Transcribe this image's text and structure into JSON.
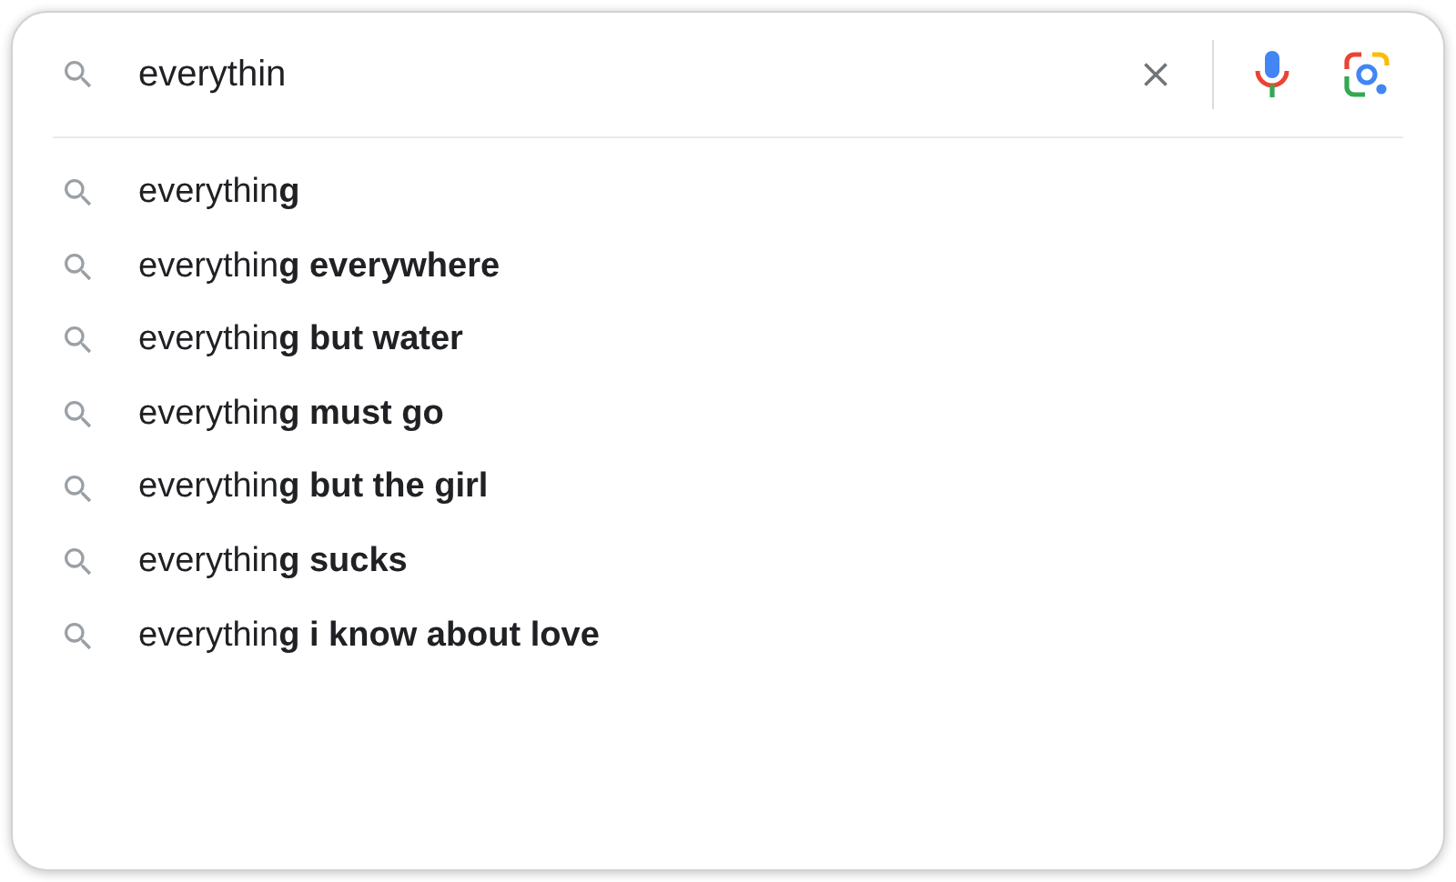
{
  "search": {
    "value": "everythin"
  },
  "suggestions": [
    {
      "text": "everythin**g**"
    },
    {
      "text": "everythin**g everywhere**"
    },
    {
      "text": "everythin**g but water**"
    },
    {
      "text": "everythin**g must go**"
    },
    {
      "text": "everythin**g but the girl**"
    },
    {
      "text": "everythin**g sucks**"
    },
    {
      "text": "everythin**g i know about love**"
    }
  ]
}
